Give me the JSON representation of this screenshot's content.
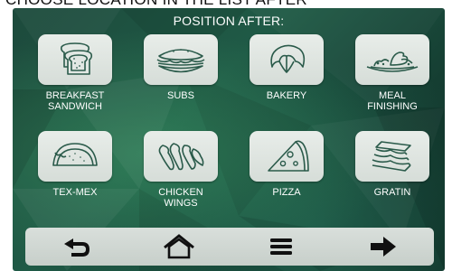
{
  "banner": "CHOOSE LOCATION IN THE LIST AFTER",
  "screen_title": "POSITION AFTER:",
  "colors": {
    "background_dark": "#143b30",
    "background_light": "#1f5a46",
    "tile": "#e1e7e3",
    "icon_stroke": "#2a5a4a",
    "text": "#ffffff"
  },
  "tiles": [
    {
      "label": "BREAKFAST\nSANDWICH",
      "icon": "toast-icon"
    },
    {
      "label": "SUBS",
      "icon": "sub-sandwich-icon"
    },
    {
      "label": "BAKERY",
      "icon": "croissant-icon"
    },
    {
      "label": "MEAL\nFINISHING",
      "icon": "plated-meal-icon"
    },
    {
      "label": "TEX-MEX",
      "icon": "taco-icon"
    },
    {
      "label": "CHICKEN\nWINGS",
      "icon": "chicken-wings-icon"
    },
    {
      "label": "PIZZA",
      "icon": "pizza-slice-icon"
    },
    {
      "label": "GRATIN",
      "icon": "lasagna-icon"
    }
  ],
  "navbar": {
    "items": [
      "back-icon",
      "home-icon",
      "menu-icon",
      "next-icon"
    ]
  }
}
